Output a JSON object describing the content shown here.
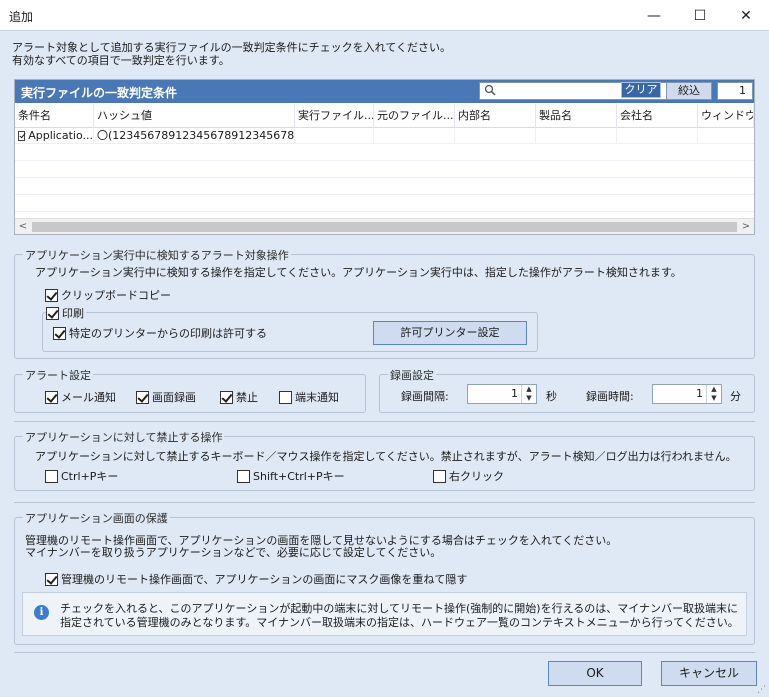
{
  "window": {
    "title": "追加",
    "minimize": "—",
    "maximize": "☐",
    "close": "✕"
  },
  "intro": {
    "line1": "アラート対象として追加する実行ファイルの一致判定条件にチェックを入れてください。",
    "line2": "有効なすべての項目で一致判定を行います。"
  },
  "match_panel": {
    "title": "実行ファイルの一致判定条件",
    "search_placeholder": "",
    "clear_label": "クリア",
    "filter_label": "絞込",
    "count": "1",
    "columns": [
      "条件名",
      "ハッシュ値",
      "実行ファイル...",
      "元のファイル...",
      "内部名",
      "製品名",
      "会社名",
      "ウィンドウタ"
    ],
    "rows": [
      {
        "name": "Applicatio...",
        "hash": "〇(12345678912345678912345678912...",
        "checked": true
      }
    ]
  },
  "alert_ops": {
    "legend": "アプリケーション実行中に検知するアラート対象操作",
    "desc": "アプリケーション実行中に検知する操作を指定してください。アプリケーション実行中は、指定した操作がアラート検知されます。",
    "clipboard": "クリップボードコピー",
    "print": "印刷",
    "allow_printer": "特定のプリンターからの印刷は許可する",
    "printer_settings_button": "許可プリンター設定"
  },
  "alert_settings": {
    "legend": "アラート設定",
    "mail": "メール通知",
    "screen_rec": "画面録画",
    "prohibit": "禁止",
    "terminal_notify": "端末通知"
  },
  "recording": {
    "legend": "録画設定",
    "interval_label": "録画間隔:",
    "interval_value": "1",
    "interval_unit": "秒",
    "duration_label": "録画時間:",
    "duration_value": "1",
    "duration_unit": "分"
  },
  "prohibited_ops": {
    "legend": "アプリケーションに対して禁止する操作",
    "desc": "アプリケーションに対して禁止するキーボード／マウス操作を指定してください。禁止されますが、アラート検知／ログ出力は行われません。",
    "ctrl_p": "Ctrl+Pキー",
    "shift_ctrl_p": "Shift+Ctrl+Pキー",
    "right_click": "右クリック"
  },
  "protection": {
    "legend": "アプリケーション画面の保護",
    "desc1": "管理機のリモート操作画面で、アプリケーションの画面を隠して見せないようにする場合はチェックを入れてください。",
    "desc2": "マイナンバーを取り扱うアプリケーションなどで、必要に応じて設定してください。",
    "mask_label": "管理機のリモート操作画面で、アプリケーションの画面にマスク画像を重ねて隠す",
    "info1": "チェックを入れると、このアプリケーションが起動中の端末に対してリモート操作(強制的に開始)を行えるのは、マイナンバー取扱端末に",
    "info2": "指定されている管理機のみとなります。マイナンバー取扱端末の指定は、ハードウェア一覧のコンテキストメニューから行ってください。"
  },
  "footer": {
    "ok": "OK",
    "cancel": "キャンセル"
  }
}
